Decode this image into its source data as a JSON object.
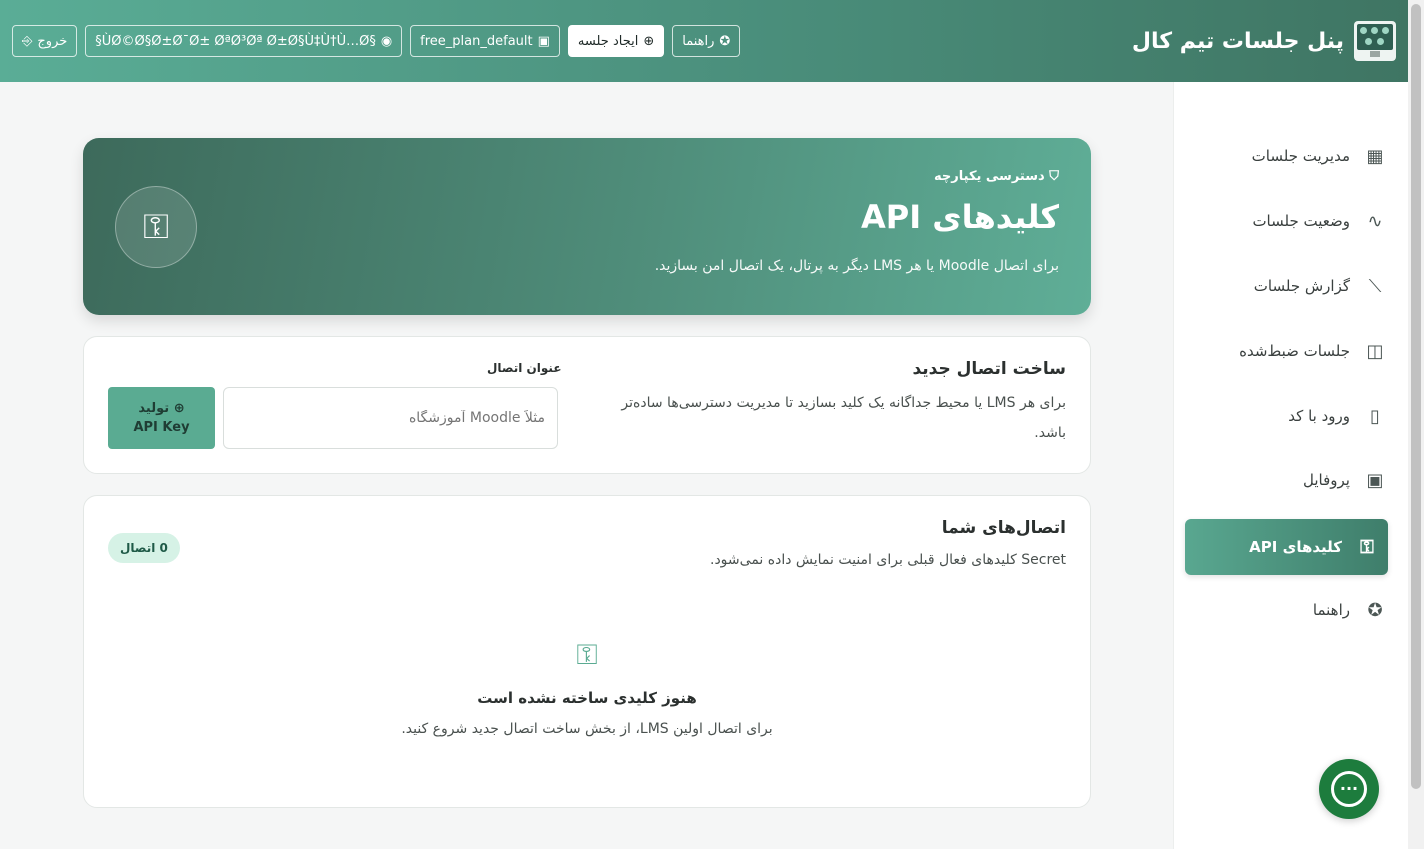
{
  "header": {
    "title": "پنل جلسات تیم کال",
    "buttons": {
      "logout": "خروج",
      "user": "§ÙØ©Ø§Ø±Ø¯Ø± ØªØ³Øª Ø±Ø§Ù‡Ù†Ù…Ø§",
      "plan": "free_plan_default",
      "create_meeting": "ایجاد جلسه",
      "help": "راهنما"
    }
  },
  "sidebar": {
    "items": [
      {
        "label": "مدیریت جلسات",
        "icon": "grid-icon"
      },
      {
        "label": "وضعیت جلسات",
        "icon": "activity-icon"
      },
      {
        "label": "گزارش جلسات",
        "icon": "chart-icon"
      },
      {
        "label": "جلسات ضبط‌شده",
        "icon": "video-icon"
      },
      {
        "label": "ورود با کد",
        "icon": "door-icon"
      },
      {
        "label": "پروفایل",
        "icon": "profile-icon"
      },
      {
        "label": "کلیدهای API",
        "icon": "key-icon",
        "active": true
      },
      {
        "label": "راهنما",
        "icon": "lifebuoy-icon"
      }
    ]
  },
  "hero": {
    "kicker": "دسترسی یکپارچه",
    "title": "کلیدهای API",
    "description": "برای اتصال Moodle یا هر LMS دیگر به پرتال، یک اتصال امن بسازید."
  },
  "create_card": {
    "title": "ساخت اتصال جدید",
    "description": "برای هر LMS یا محیط جداگانه یک کلید بسازید تا مدیریت دسترسی‌ها ساده‌تر باشد.",
    "field_label": "عنوان اتصال",
    "field_placeholder": "مثلاً Moodle آموزشگاه",
    "generate_line1": "تولید",
    "generate_line2": "API Key"
  },
  "connections_card": {
    "title": "اتصال‌های شما",
    "description": "Secret کلیدهای فعال قبلی برای امنیت نمایش داده نمی‌شود.",
    "count_badge": "0 اتصال",
    "empty_title": "هنوز کلیدی ساخته نشده است",
    "empty_description": "برای اتصال اولین LMS، از بخش ساخت اتصال جدید شروع کنید."
  },
  "colors": {
    "accent": "#5aab92",
    "accent_dark": "#3f7563",
    "chat": "#1d7c3d"
  }
}
